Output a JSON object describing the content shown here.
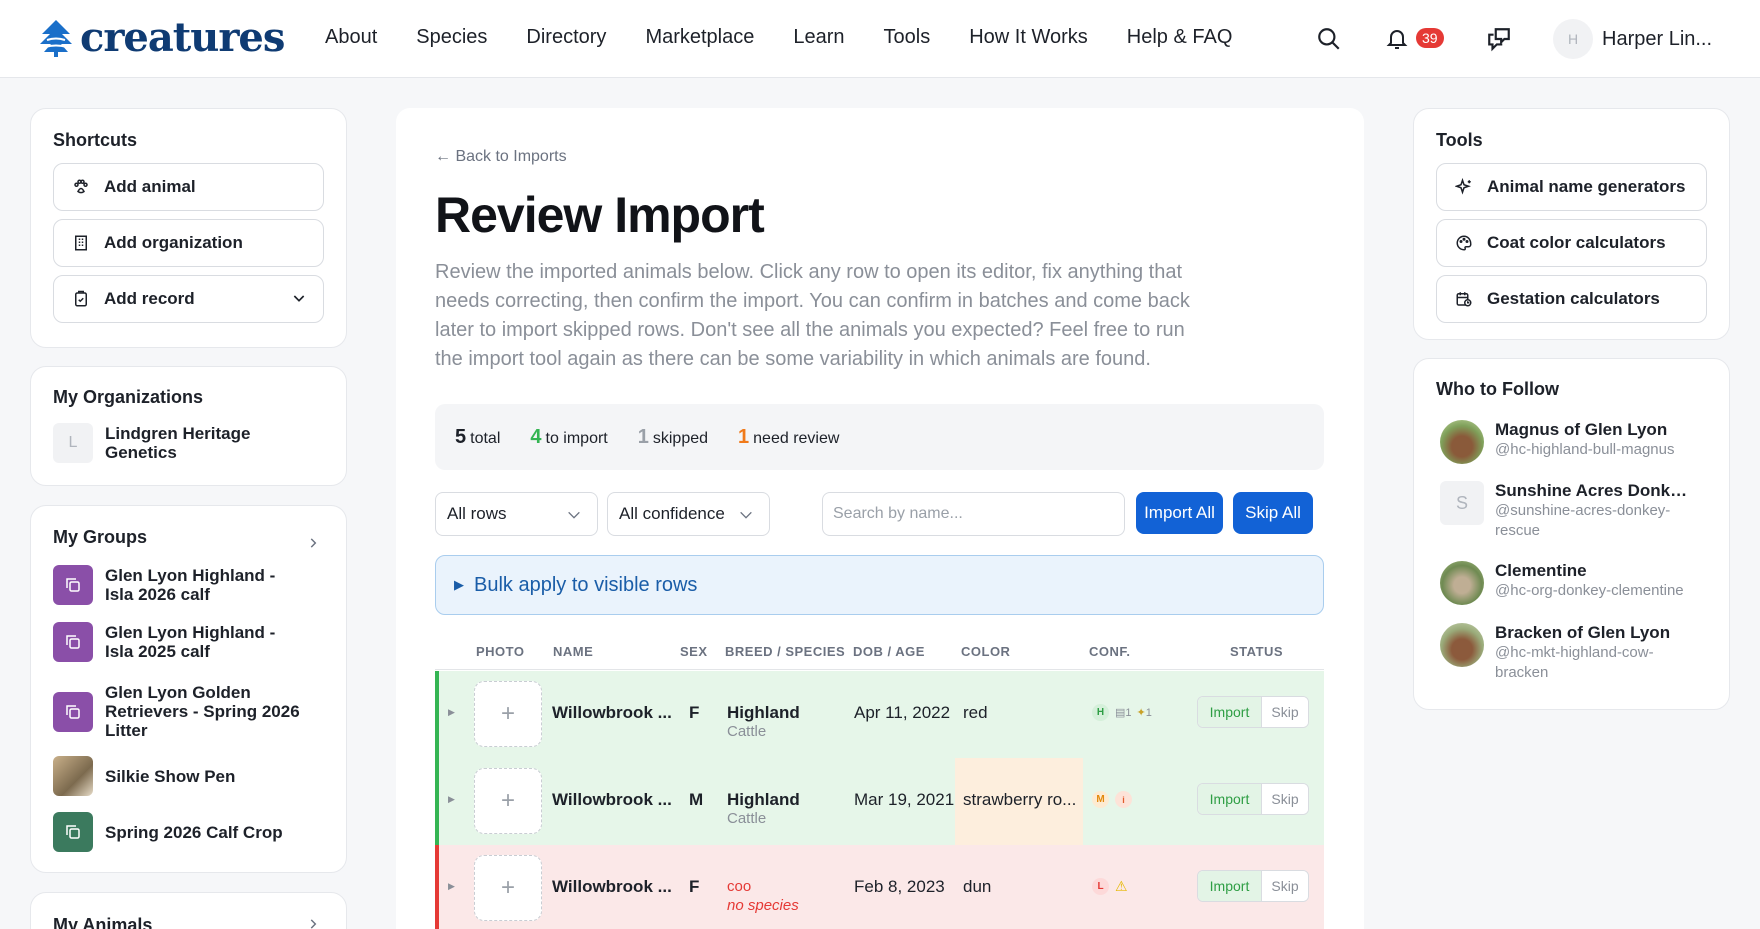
{
  "brand": {
    "name": "creatures"
  },
  "nav": [
    "About",
    "Species",
    "Directory",
    "Marketplace",
    "Learn",
    "Tools",
    "How It Works",
    "Help & FAQ"
  ],
  "header": {
    "notification_count": "39",
    "user_initial": "H",
    "user_name": "Harper Lin..."
  },
  "shortcuts": {
    "title": "Shortcuts",
    "items": [
      "Add animal",
      "Add organization",
      "Add record"
    ]
  },
  "organizations": {
    "title": "My Organizations",
    "items": [
      {
        "initial": "L",
        "name": "Lindgren Heritage Genetics"
      }
    ]
  },
  "groups": {
    "title": "My Groups",
    "items": [
      "Glen Lyon Highland - Isla 2026 calf",
      "Glen Lyon Highland - Isla 2025 calf",
      "Glen Lyon Golden Retrievers - Spring 2026 Litter",
      "Silkie Show Pen",
      "Spring 2026 Calf Crop"
    ]
  },
  "animals": {
    "title": "My Animals"
  },
  "main": {
    "back": "← Back to Imports",
    "title": "Review Import",
    "description": "Review the imported animals below. Click any row to open its editor, fix anything that needs correcting, then confirm the import. You can confirm in batches and come back later to import skipped rows. Don't see all the animals you expected? Feel free to run the import tool again as there can be some variability in which animals are found.",
    "stats": {
      "total_n": "5",
      "total_label": "total",
      "import_n": "4",
      "import_label": "to import",
      "skipped_n": "1",
      "skipped_label": "skipped",
      "review_n": "1",
      "review_label": "need review"
    },
    "filters": {
      "rows": "All rows",
      "confidence": "All confidence",
      "search_placeholder": "Search by name...",
      "import_all": "Import All",
      "skip_all": "Skip All"
    },
    "bulk": "Bulk apply to visible rows",
    "columns": [
      "PHOTO",
      "NAME",
      "SEX",
      "BREED / SPECIES",
      "DOB / AGE",
      "COLOR",
      "CONF.",
      "STATUS"
    ],
    "rows": [
      {
        "name": "Willowbrook ...",
        "sex": "F",
        "breed": "Highland",
        "species": "Cattle",
        "dob": "Apr 11, 2022",
        "color": "red",
        "conf": "H",
        "c1": "1",
        "c2": "1",
        "status_import": "Import",
        "status_skip": "Skip"
      },
      {
        "name": "Willowbrook ...",
        "sex": "M",
        "breed": "Highland",
        "species": "Cattle",
        "dob": "Mar 19, 2021",
        "color": "strawberry ro...",
        "conf": "M",
        "status_import": "Import",
        "status_skip": "Skip"
      },
      {
        "name": "Willowbrook ...",
        "sex": "F",
        "breed": "coo",
        "species": "no species",
        "dob": "Feb 8, 2023",
        "color": "dun",
        "conf": "L",
        "status_import": "Import",
        "status_skip": "Skip"
      }
    ]
  },
  "tools": {
    "title": "Tools",
    "items": [
      "Animal name generators",
      "Coat color calculators",
      "Gestation calculators"
    ]
  },
  "follow": {
    "title": "Who to Follow",
    "items": [
      {
        "name": "Magnus of Glen Lyon",
        "handle": "@hc-highland-bull-magnus"
      },
      {
        "initial": "S",
        "name": "Sunshine Acres Donkey ...",
        "handle": "@sunshine-acres-donkey-rescue"
      },
      {
        "name": "Clementine",
        "handle": "@hc-org-donkey-clementine"
      },
      {
        "name": "Bracken of Glen Lyon",
        "handle": "@hc-mkt-highland-cow-bracken"
      }
    ]
  },
  "colors": {
    "accent": "#1262d6",
    "brand": "#0f3b73",
    "ok": "#34b553",
    "error": "#e53935",
    "warn": "#f07a1a"
  }
}
